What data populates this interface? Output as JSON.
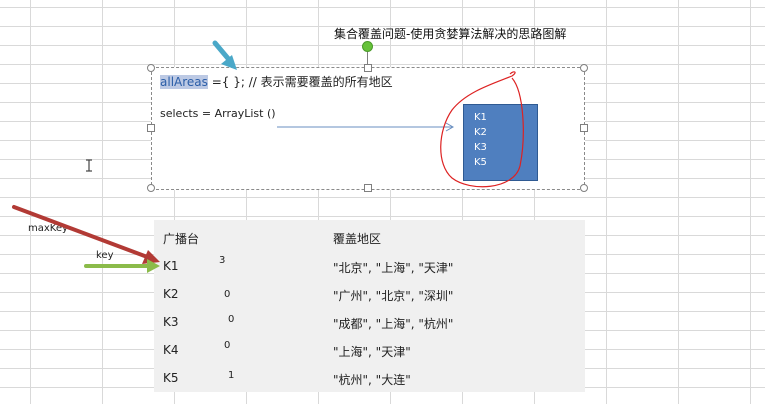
{
  "diagram": {
    "title": "集合覆盖问题-使用贪婪算法解决的思路图解",
    "code_line1_highlight": "allAreas",
    "code_line1_rest": " ={ }; // 表示需要覆盖的所有地区",
    "code_line2": "selects = ArrayList ()",
    "selects_box": [
      "K1",
      "K2",
      "K3",
      "K5"
    ],
    "label_maxkey": "maxKey",
    "label_key": "key",
    "arrow_colors": {
      "blue": "#4aa8c8",
      "red": "#c0392b",
      "green": "#8bbb4a",
      "link": "#6a8fc0"
    }
  },
  "table": {
    "headers": {
      "station": "广播台",
      "areas": "覆盖地区"
    },
    "rows": [
      {
        "key": "K1",
        "count": "3",
        "areas": "\"北京\", \"上海\", \"天津\""
      },
      {
        "key": "K2",
        "count": "0",
        "areas": "\"广州\", \"北京\", \"深圳\""
      },
      {
        "key": "K3",
        "count": "0",
        "areas": "\"成都\", \"上海\", \"杭州\""
      },
      {
        "key": "K4",
        "count": "0",
        "areas": "\"上海\", \"天津\""
      },
      {
        "key": "K5",
        "count": "1",
        "areas": "\"杭州\", \"大连\""
      }
    ]
  }
}
